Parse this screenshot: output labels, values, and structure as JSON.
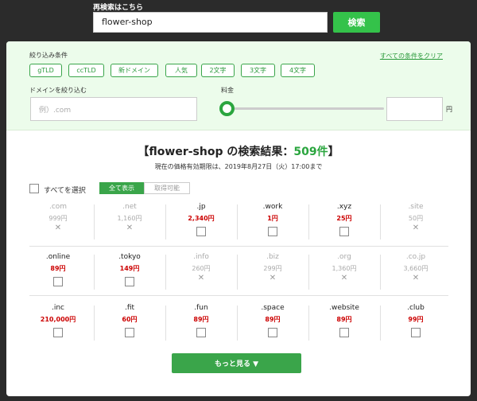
{
  "search": {
    "label": "再検索はこちら",
    "value": "flower-shop",
    "button": "検索"
  },
  "filters": {
    "title": "絞り込み条件",
    "clear_all": "すべての条件をクリア",
    "chips": [
      "gTLD",
      "ccTLD",
      "新ドメイン",
      "人気",
      "2文字",
      "3文字",
      "4文字"
    ],
    "domain_label": "ドメインを絞り込む",
    "domain_placeholder": "例）.com",
    "price_label": "料金",
    "price_unit": "円"
  },
  "results": {
    "title_prefix": "【flower-shop の検索結果：",
    "count": "509件",
    "title_suffix": "】",
    "validity": "現在の価格有効期限は、2019年8月27日（火）17:00まで",
    "select_all": "すべてを選択",
    "tab_all": "全て表示",
    "tab_available": "取得可能",
    "rows": [
      [
        {
          "tld": ".com",
          "price": "999円",
          "available": false
        },
        {
          "tld": ".net",
          "price": "1,160円",
          "available": false
        },
        {
          "tld": ".jp",
          "price": "2,340円",
          "available": true
        },
        {
          "tld": ".work",
          "price": "1円",
          "available": true
        },
        {
          "tld": ".xyz",
          "price": "25円",
          "available": true
        },
        {
          "tld": ".site",
          "price": "50円",
          "available": false
        }
      ],
      [
        {
          "tld": ".online",
          "price": "89円",
          "available": true
        },
        {
          "tld": ".tokyo",
          "price": "149円",
          "available": true
        },
        {
          "tld": ".info",
          "price": "260円",
          "available": false
        },
        {
          "tld": ".biz",
          "price": "299円",
          "available": false
        },
        {
          "tld": ".org",
          "price": "1,360円",
          "available": false
        },
        {
          "tld": ".co.jp",
          "price": "3,660円",
          "available": false
        }
      ],
      [
        {
          "tld": ".inc",
          "price": "210,000円",
          "available": true
        },
        {
          "tld": ".fit",
          "price": "60円",
          "available": true
        },
        {
          "tld": ".fun",
          "price": "89円",
          "available": true
        },
        {
          "tld": ".space",
          "price": "89円",
          "available": true
        },
        {
          "tld": ".website",
          "price": "89円",
          "available": true
        },
        {
          "tld": ".club",
          "price": "99円",
          "available": true
        }
      ]
    ],
    "more_button": "もっと見る ▼"
  },
  "colors": {
    "accent": "#34c24a",
    "price_available": "#cc0000",
    "filter_bg": "#ecfceb"
  }
}
